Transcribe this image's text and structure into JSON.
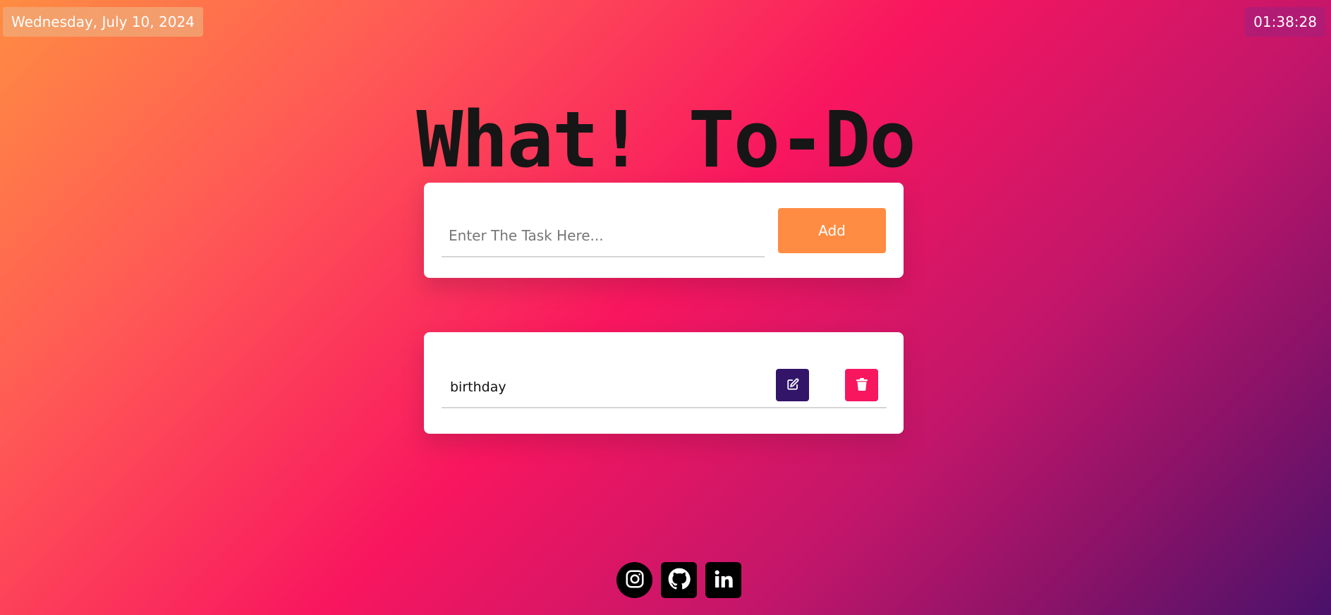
{
  "header": {
    "date": "Wednesday, July 10, 2024",
    "time": "01:38:28"
  },
  "title": "What! To-Do",
  "task_form": {
    "input_value": "",
    "input_placeholder": "Enter The Task Here...",
    "add_label": "Add"
  },
  "tasks": [
    {
      "text": "birthday",
      "edit_icon": "edit-icon",
      "delete_icon": "trash-icon"
    }
  ],
  "socials": [
    {
      "name": "instagram-icon"
    },
    {
      "name": "github-icon"
    },
    {
      "name": "linkedin-icon"
    }
  ],
  "colors": {
    "accent_orange": "#ff8c42",
    "edit_purple": "#321469",
    "delete_pink": "#f8165f"
  }
}
